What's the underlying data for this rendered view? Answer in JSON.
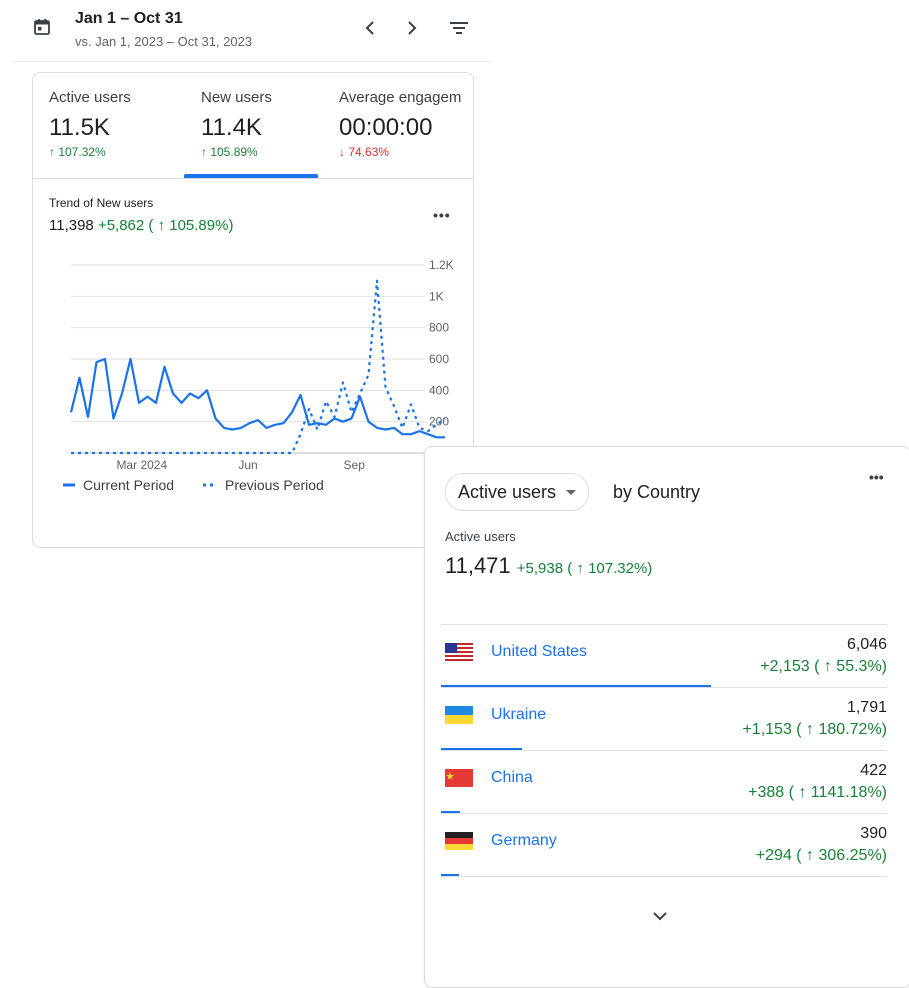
{
  "header": {
    "date_range": "Jan 1 – Oct 31",
    "compare_range": "vs. Jan 1, 2023 – Oct 31, 2023"
  },
  "metrics": [
    {
      "label": "Active users",
      "value": "11.5K",
      "delta": "↑ 107.32%",
      "direction": "up"
    },
    {
      "label": "New users",
      "value": "11.4K",
      "delta": "↑ 105.89%",
      "direction": "up"
    },
    {
      "label": "Average engagem",
      "value": "00:00:00",
      "delta": "↓ 74.63%",
      "direction": "down"
    }
  ],
  "trend": {
    "title": "Trend of New users",
    "total": "11,398",
    "change": "+5,862 ( ↑ 105.89%)",
    "menu": "•••"
  },
  "chart_data": {
    "type": "line",
    "x_tick_labels": [
      "Mar 2024",
      "Jun",
      "Sep"
    ],
    "y_tick_labels": [
      "1.2K",
      "1K",
      "800",
      "600",
      "400",
      "200"
    ],
    "ylim": [
      0,
      1200
    ],
    "grid": true,
    "legend_position": "bottom",
    "series": [
      {
        "name": "Current Period",
        "color": "#1a73e8",
        "style": "solid",
        "values": [
          260,
          480,
          230,
          580,
          600,
          220,
          380,
          600,
          320,
          360,
          320,
          550,
          380,
          320,
          380,
          350,
          400,
          220,
          160,
          150,
          160,
          190,
          210,
          160,
          180,
          190,
          260,
          370,
          180,
          190,
          180,
          220,
          200,
          220,
          360,
          200,
          160,
          150,
          160,
          120,
          120,
          140,
          120,
          100,
          100
        ]
      },
      {
        "name": "Previous Period",
        "color": "#1a73e8",
        "style": "dotted",
        "values": [
          0,
          0,
          0,
          0,
          0,
          0,
          0,
          0,
          0,
          0,
          0,
          0,
          0,
          0,
          0,
          0,
          0,
          0,
          0,
          0,
          0,
          0,
          0,
          0,
          0,
          0,
          0,
          120,
          280,
          150,
          330,
          230,
          450,
          260,
          380,
          500,
          1100,
          420,
          300,
          160,
          310,
          160,
          140,
          180,
          220
        ]
      }
    ]
  },
  "country_card": {
    "dimension_selector": "Active users",
    "by_label": "by Country",
    "menu": "•••",
    "metric_label": "Active users",
    "total": "11,471",
    "change": "+5,938 ( ↑ 107.32%)",
    "rows": [
      {
        "country": "United States",
        "flag": "us-flag-icon",
        "value": "6,046",
        "delta": "+2,153 ( ↑ 55.3%)",
        "share": 0.6
      },
      {
        "country": "Ukraine",
        "flag": "ukraine-flag-icon",
        "value": "1,791",
        "delta": "+1,153 ( ↑ 180.72%)",
        "share": 0.18
      },
      {
        "country": "China",
        "flag": "china-flag-icon",
        "value": "422",
        "delta": "+388 ( ↑ 1141.18%)",
        "share": 0.043
      },
      {
        "country": "Germany",
        "flag": "germany-flag-icon",
        "value": "390",
        "delta": "+294 ( ↑ 306.25%)",
        "share": 0.04
      }
    ]
  }
}
